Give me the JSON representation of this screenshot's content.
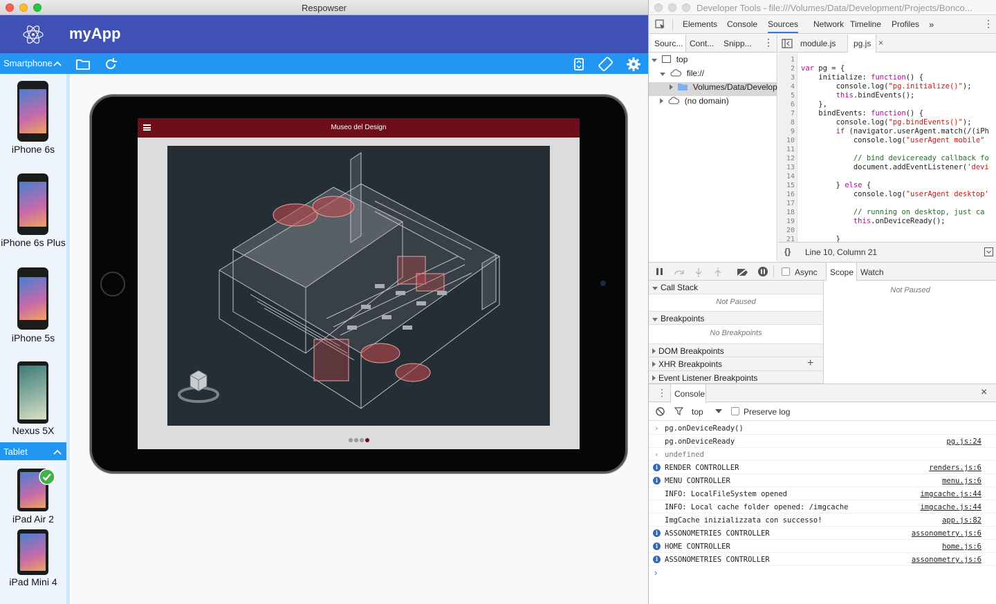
{
  "left_window": {
    "title": "Respowser",
    "app_name": "myApp",
    "device_group_smartphone": "Smartphone",
    "device_group_tablet": "Tablet",
    "devices": [
      {
        "label": "iPhone 6s"
      },
      {
        "label": "iPhone 6s Plus"
      },
      {
        "label": "iPhone 5s"
      },
      {
        "label": "Nexus 5X"
      },
      {
        "label": "iPad Air 2"
      },
      {
        "label": "iPad Mini 4"
      }
    ],
    "preview": {
      "app_title": "Museo del Design",
      "pager": {
        "total": 4,
        "current": 4
      }
    },
    "colors": {
      "header": "#3f51b5",
      "toolbar": "#2196f3",
      "app_nav": "#6d0f1b"
    }
  },
  "devtools": {
    "title": "Developer Tools - file:///Volumes/Data/Development/Projects/Bonco...",
    "tabs": [
      "Elements",
      "Console",
      "Sources",
      "Network",
      "Timeline",
      "Profiles"
    ],
    "selected_tab": "Sources",
    "nav_tabs": [
      "Sourc...",
      "Cont...",
      "Snipp..."
    ],
    "file_tabs": [
      "module.js",
      "pg.js"
    ],
    "tree": [
      "top",
      "file://",
      "Volumes/Data/Developm",
      "(no domain)"
    ],
    "code_lines": [
      "var pg = {",
      "    initialize: function() {",
      "        console.log(\"pg.initialize()\");",
      "        this.bindEvents();",
      "    },",
      "    bindEvents: function() {",
      "        console.log(\"pg.bindEvents()\");",
      "        if (navigator.userAgent.match(/(iPh",
      "            console.log(\"userAgent mobile\"",
      "",
      "            // bind deviceready callback fo",
      "            document.addEventListener('devi",
      "",
      "        } else {",
      "            console.log(\"userAgent desktop'",
      "",
      "            // running on desktop, just ca",
      "            this.onDeviceReady();",
      "",
      "        }"
    ],
    "cursor_status": "Line 10, Column 21",
    "async_label": "Async",
    "scope_tab": "Scope",
    "watch_tab": "Watch",
    "not_paused": "Not Paused",
    "sections": {
      "call_stack": "Call Stack",
      "call_stack_body": "Not Paused",
      "breakpoints": "Breakpoints",
      "breakpoints_body": "No Breakpoints",
      "dom_breakpoints": "DOM Breakpoints",
      "xhr_breakpoints": "XHR Breakpoints",
      "event_listener_breakpoints": "Event Listener Breakpoints"
    },
    "console_tab": "Console",
    "console_context": "top",
    "preserve_log": "Preserve log",
    "console_rows": [
      {
        "kind": "input",
        "msg": "pg.onDeviceReady()",
        "src": ""
      },
      {
        "kind": "log",
        "msg": "pg.onDeviceReady",
        "src": "pg.js:24"
      },
      {
        "kind": "result",
        "msg": "undefined",
        "src": ""
      },
      {
        "kind": "info",
        "msg": "RENDER CONTROLLER",
        "src": "renders.js:6"
      },
      {
        "kind": "info",
        "msg": "MENU CONTROLLER",
        "src": "menu.js:6"
      },
      {
        "kind": "log",
        "msg": "INFO: LocalFileSystem opened",
        "src": "imgcache.js:44"
      },
      {
        "kind": "log",
        "msg": "INFO: Local cache folder opened: /imgcache",
        "src": "imgcache.js:44"
      },
      {
        "kind": "log",
        "msg": "ImgCache inizializzata con successo!",
        "src": "app.js:82"
      },
      {
        "kind": "info",
        "msg": "ASSONOMETRIES CONTROLLER",
        "src": "assonometry.js:6"
      },
      {
        "kind": "info",
        "msg": "HOME CONTROLLER",
        "src": "home.js:6"
      },
      {
        "kind": "info",
        "msg": "ASSONOMETRIES CONTROLLER",
        "src": "assonometry.js:6"
      }
    ]
  }
}
